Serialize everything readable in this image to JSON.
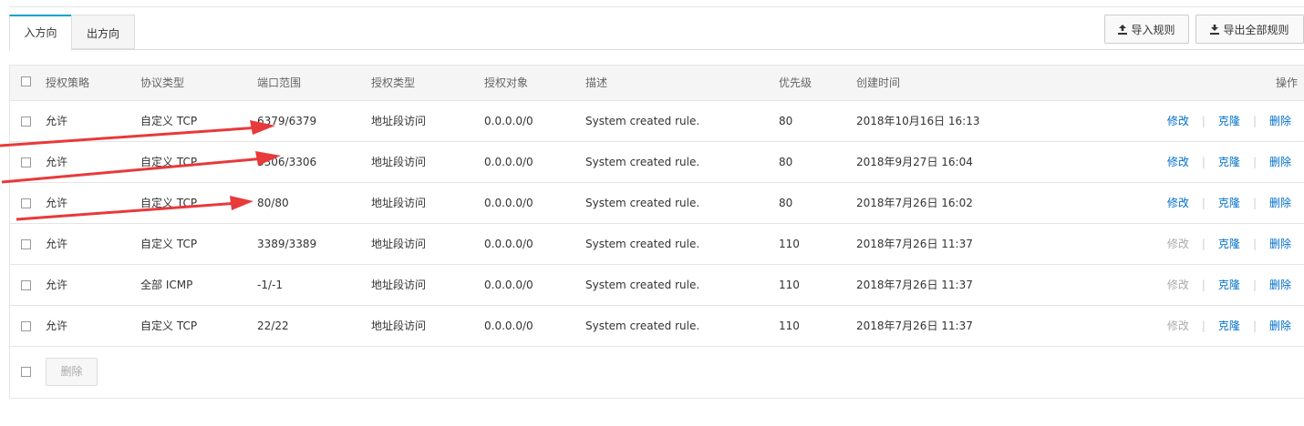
{
  "tabs": [
    {
      "label": "入方向",
      "active": true
    },
    {
      "label": "出方向",
      "active": false
    }
  ],
  "toolbar": {
    "import_label": "导入规则",
    "export_label": "导出全部规则"
  },
  "table": {
    "headers": {
      "action": "授权策略",
      "protocol": "协议类型",
      "port": "端口范围",
      "auth_type": "授权类型",
      "auth_object": "授权对象",
      "description": "描述",
      "priority": "优先级",
      "created": "创建时间",
      "operations": "操作"
    },
    "rows": [
      {
        "action": "允许",
        "protocol": "自定义 TCP",
        "port": "6379/6379",
        "auth_type": "地址段访问",
        "auth_object": "0.0.0.0/0",
        "description": "System created rule.",
        "priority": "80",
        "created": "2018年10月16日 16:13",
        "modify": "修改",
        "clone": "克隆",
        "delete": "删除",
        "modify_enabled": true
      },
      {
        "action": "允许",
        "protocol": "自定义 TCP",
        "port": "3306/3306",
        "auth_type": "地址段访问",
        "auth_object": "0.0.0.0/0",
        "description": "System created rule.",
        "priority": "80",
        "created": "2018年9月27日 16:04",
        "modify": "修改",
        "clone": "克隆",
        "delete": "删除",
        "modify_enabled": true
      },
      {
        "action": "允许",
        "protocol": "自定义 TCP",
        "port": "80/80",
        "auth_type": "地址段访问",
        "auth_object": "0.0.0.0/0",
        "description": "System created rule.",
        "priority": "80",
        "created": "2018年7月26日 16:02",
        "modify": "修改",
        "clone": "克隆",
        "delete": "删除",
        "modify_enabled": true
      },
      {
        "action": "允许",
        "protocol": "自定义 TCP",
        "port": "3389/3389",
        "auth_type": "地址段访问",
        "auth_object": "0.0.0.0/0",
        "description": "System created rule.",
        "priority": "110",
        "created": "2018年7月26日 11:37",
        "modify": "修改",
        "clone": "克隆",
        "delete": "删除",
        "modify_enabled": false
      },
      {
        "action": "允许",
        "protocol": "全部 ICMP",
        "port": "-1/-1",
        "auth_type": "地址段访问",
        "auth_object": "0.0.0.0/0",
        "description": "System created rule.",
        "priority": "110",
        "created": "2018年7月26日 11:37",
        "modify": "修改",
        "clone": "克隆",
        "delete": "删除",
        "modify_enabled": false
      },
      {
        "action": "允许",
        "protocol": "自定义 TCP",
        "port": "22/22",
        "auth_type": "地址段访问",
        "auth_object": "0.0.0.0/0",
        "description": "System created rule.",
        "priority": "110",
        "created": "2018年7月26日 11:37",
        "modify": "修改",
        "clone": "克隆",
        "delete": "删除",
        "modify_enabled": false
      }
    ]
  },
  "footer": {
    "delete_label": "删除"
  },
  "colors": {
    "link": "#0070cc",
    "disabled": "#aaaaaa",
    "tab_accent": "#00a2ca",
    "annotation_arrow": "#e8393b"
  }
}
